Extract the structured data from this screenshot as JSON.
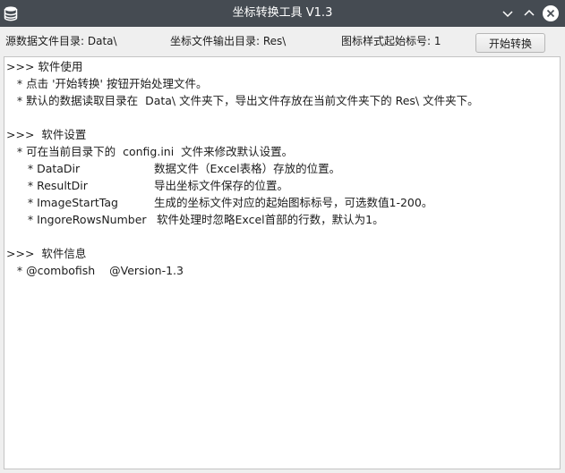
{
  "window": {
    "title": "坐标转换工具 V1.3",
    "app_icon": "database-icon",
    "controls": {
      "minimize_icon": "chevron-down-icon",
      "maximize_icon": "chevron-up-icon",
      "close_icon": "close-icon"
    }
  },
  "toolbar": {
    "source_dir_label": "源数据文件目录: Data\\",
    "output_dir_label": "坐标文件输出目录: Res\\",
    "start_tag_label": "图标样式起始标号: 1",
    "start_button_label": "开始转换"
  },
  "content": {
    "usage": {
      "heading": ">>> 软件使用",
      "line1": "   * 点击 '开始转换' 按钮开始处理文件。",
      "line2": "   * 默认的数据读取目录在  Data\\ 文件夹下，导出文件存放在当前文件夹下的 Res\\ 文件夹下。"
    },
    "settings": {
      "heading": ">>>  软件设置",
      "intro": "   * 可在当前目录下的  config.ini  文件来修改默认设置。",
      "items": [
        {
          "key": "      * DataDir",
          "desc": "数据文件（Excel表格）存放的位置。"
        },
        {
          "key": "      * ResultDir",
          "desc": "导出坐标文件保存的位置。"
        },
        {
          "key": "      * ImageStartTag",
          "desc": "生成的坐标文件对应的起始图标标号，可选数值1-200。"
        },
        {
          "key": "      * IngoreRowsNumber",
          "desc": "软件处理时忽略Excel首部的行数，默认为1。"
        }
      ]
    },
    "info": {
      "heading": ">>>  软件信息",
      "line1": "   * @combofish    @Version-1.3"
    }
  }
}
